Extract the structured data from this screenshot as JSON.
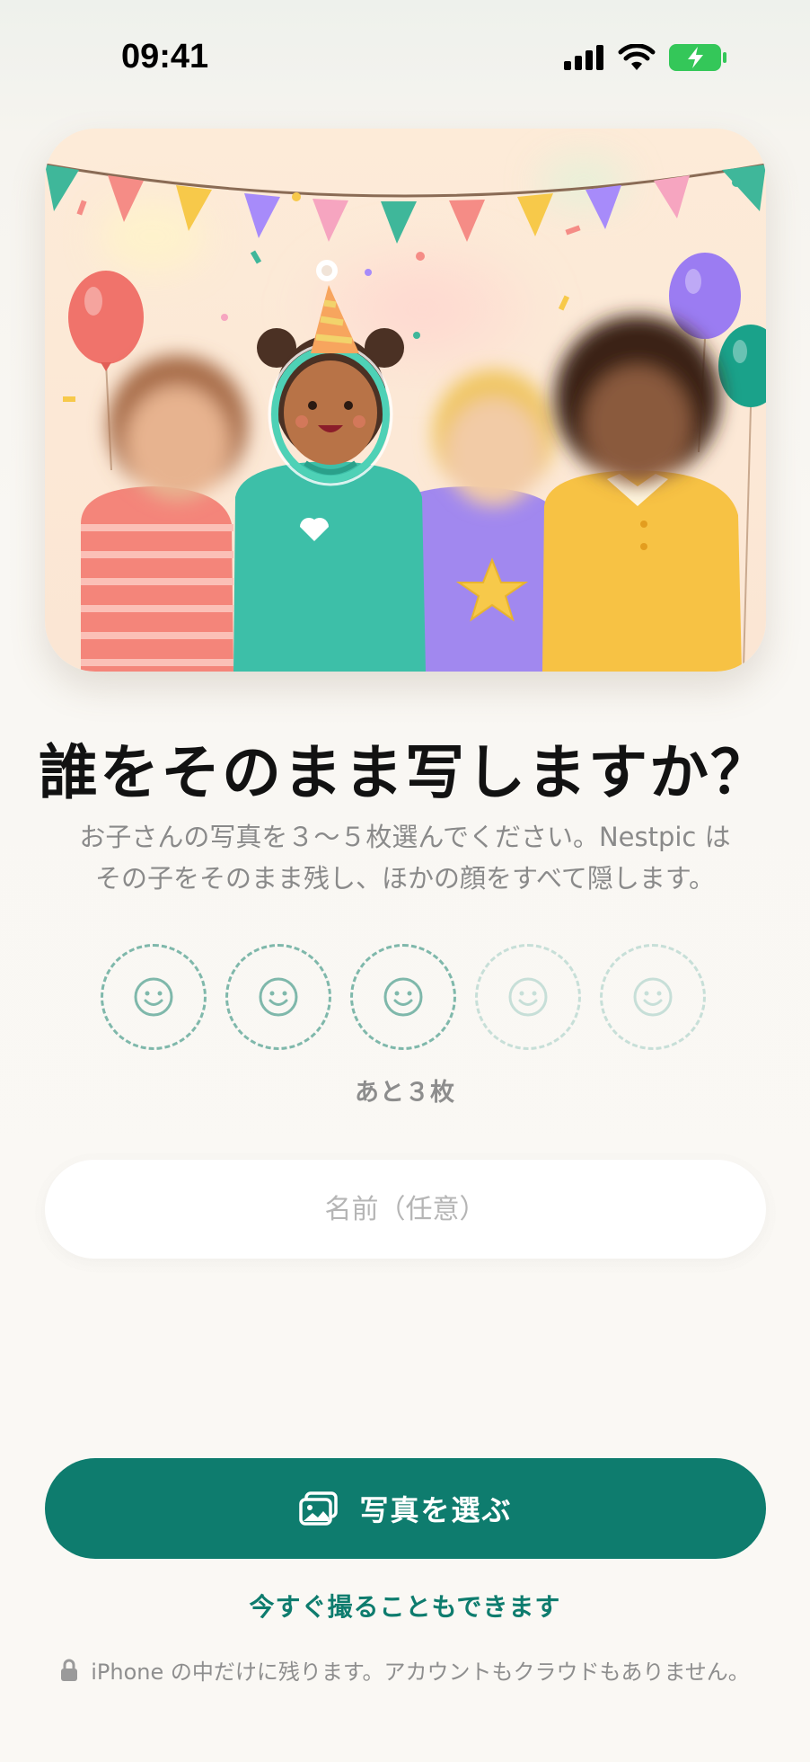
{
  "status_bar": {
    "time": "09:41"
  },
  "onboarding": {
    "title": "誰をそのまま写しますか？",
    "subtitle_line1": "お子さんの写真を３〜５枚選んでください。Nestpic は",
    "subtitle_line2": "その子をそのまま残し、ほかの顔をすべて隠します。",
    "photo_slots": {
      "required_min": 3,
      "max": 5,
      "filled": 0,
      "slot_icon": "smiley-icon",
      "remaining_label": "あと３枚"
    },
    "name_input": {
      "placeholder": "名前（任意）",
      "value": ""
    },
    "choose_button": {
      "label": "写真を選ぶ",
      "icon": "photos-icon"
    },
    "camera_link": {
      "label": "今すぐ撮ることもできます"
    },
    "privacy_note": {
      "text": "iPhone の中だけに残ります。アカウントもクラウドもありません。",
      "icon": "lock-icon"
    }
  },
  "colors": {
    "primary": "#0e7c6e",
    "slot_ring_active": "#7fb8ab",
    "slot_ring_inactive": "#c7dfd8",
    "battery": "#34c759"
  }
}
